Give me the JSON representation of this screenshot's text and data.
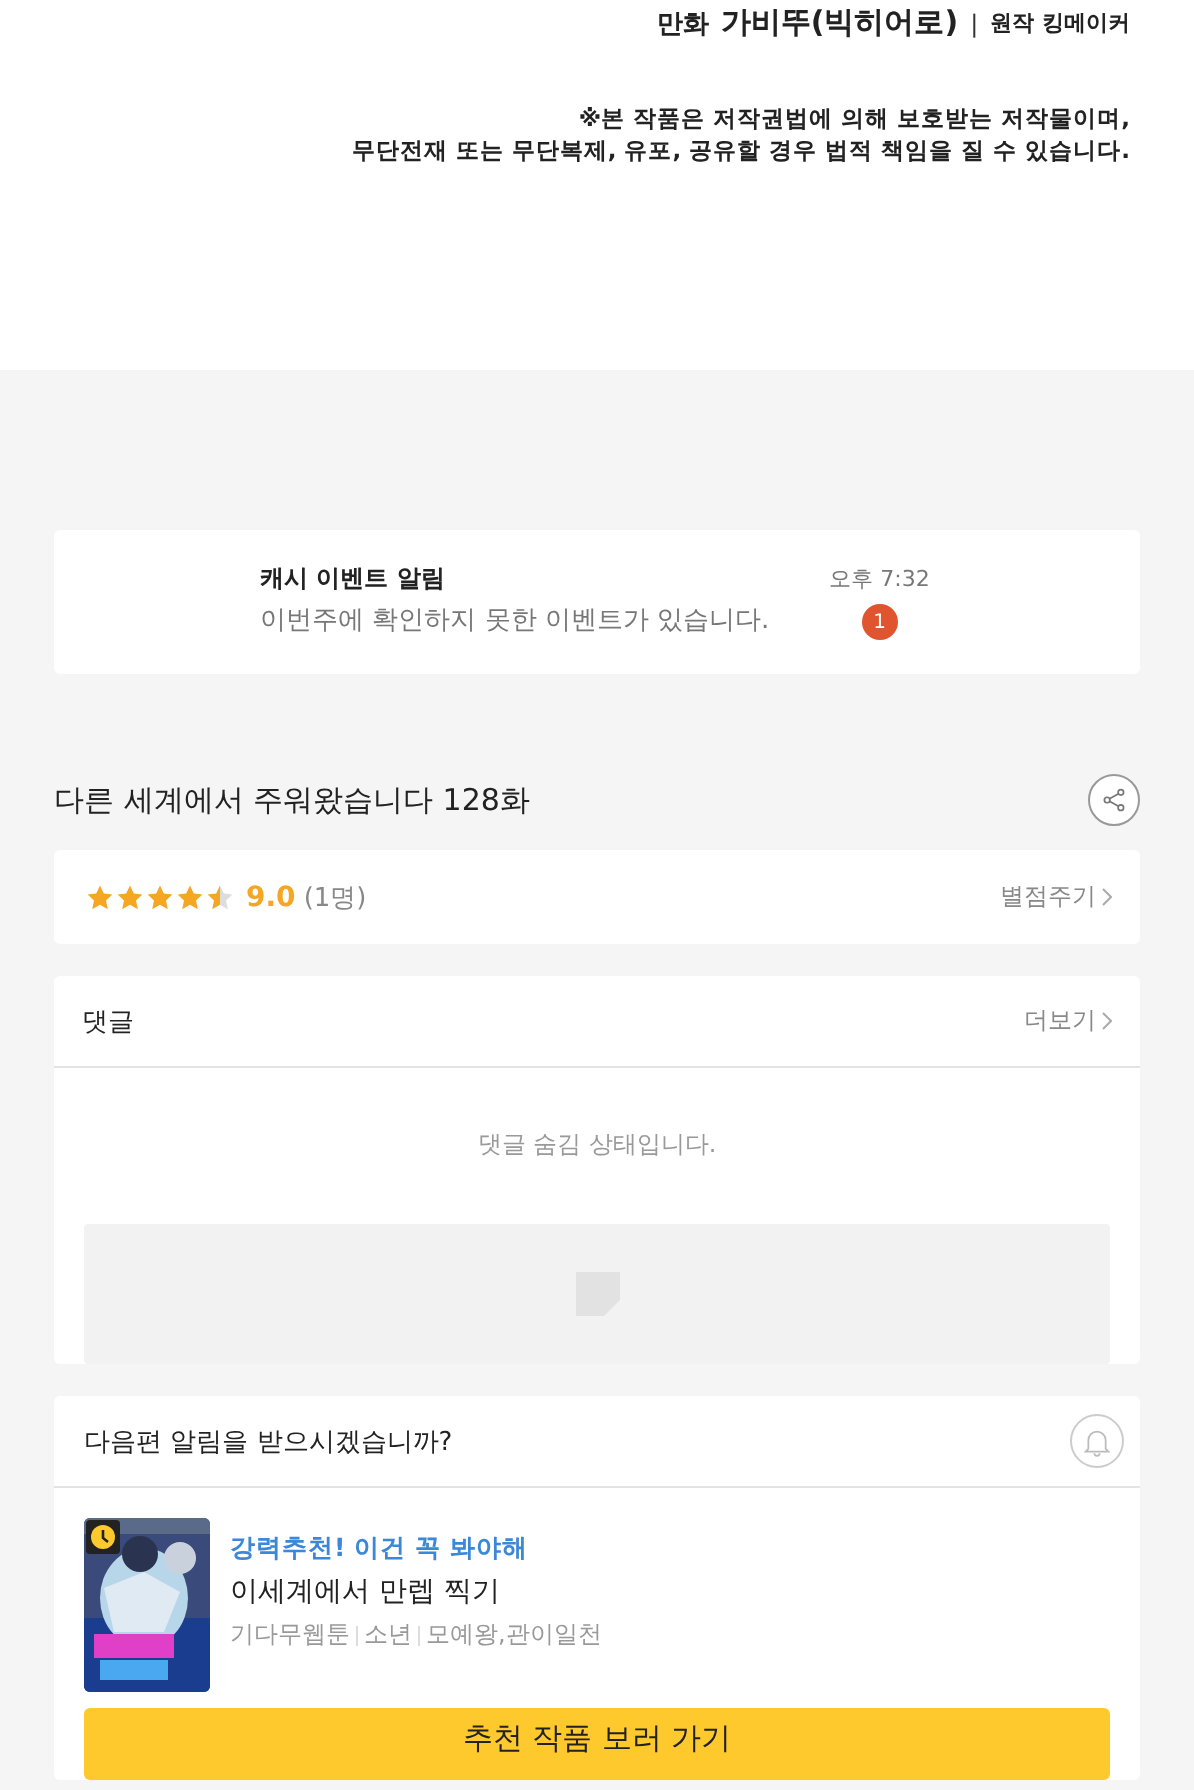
{
  "credits": {
    "art_label": "만화",
    "art_name": "가비뚜(빅히어로)",
    "separator": "|",
    "story": "원작 킹메이커"
  },
  "notice": {
    "lines": [
      "※본 작품은 저작권법에 의해 보호받는 저작물이며,",
      "무단전재 또는 무단복제, 유포, 공유할 경우 법적 책임을 질 수 있습니다."
    ]
  },
  "event_notification": {
    "title": "캐시 이벤트 알림",
    "message": "이번주에 확인하지 못한 이벤트가 있습니다.",
    "time": "오후 7:32",
    "badge": "1"
  },
  "episode": {
    "title": "다른 세계에서 주워왔습니다 128화"
  },
  "rating": {
    "stars": 4.5,
    "score": "9.0",
    "count": "(1명)",
    "action": "별점주기"
  },
  "comments": {
    "title": "댓글",
    "more": "더보기",
    "message": "댓글 숨김 상태입니다."
  },
  "next_alert": {
    "question": "다음편 알림을 받으시겠습니까?"
  },
  "recommendation": {
    "tagline": "강력추천! 이건 꼭 봐야해",
    "title": "이세계에서 만렙 찍기",
    "meta": [
      "기다무웹툰",
      "소년",
      "모예왕,관이일천"
    ],
    "button": "추천 작품 보러 가기"
  }
}
